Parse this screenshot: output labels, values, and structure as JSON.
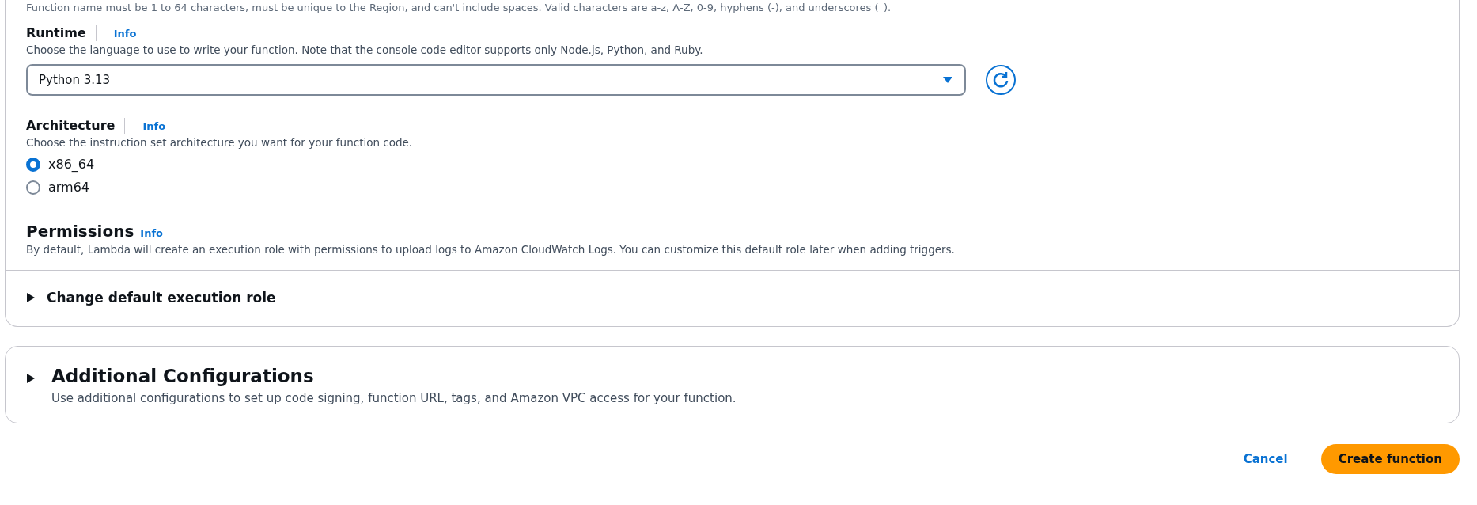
{
  "top_hint": "Function name must be 1 to 64 characters, must be unique to the Region, and can't include spaces. Valid characters are a-z, A-Z, 0-9, hyphens (-), and underscores (_).",
  "runtime": {
    "label": "Runtime",
    "info": "Info",
    "description": "Choose the language to use to write your function. Note that the console code editor supports only Node.js, Python, and Ruby.",
    "select": {
      "value": "Python 3.13"
    }
  },
  "architecture": {
    "label": "Architecture",
    "info": "Info",
    "description": "Choose the instruction set architecture you want for your function code.",
    "options": [
      {
        "label": "x86_64",
        "selected": true
      },
      {
        "label": "arm64",
        "selected": false
      }
    ]
  },
  "permissions": {
    "title": "Permissions",
    "info": "Info",
    "description": "By default, Lambda will create an execution role with permissions to upload logs to Amazon CloudWatch Logs. You can customize this default role later when adding triggers."
  },
  "execution_role": {
    "label": "Change default execution role",
    "expanded": false
  },
  "additional": {
    "title": "Additional Configurations",
    "description": "Use additional configurations to set up code signing, function URL, tags, and Amazon VPC access for your function.",
    "expanded": false
  },
  "actions": {
    "cancel": "Cancel",
    "create": "Create function"
  }
}
